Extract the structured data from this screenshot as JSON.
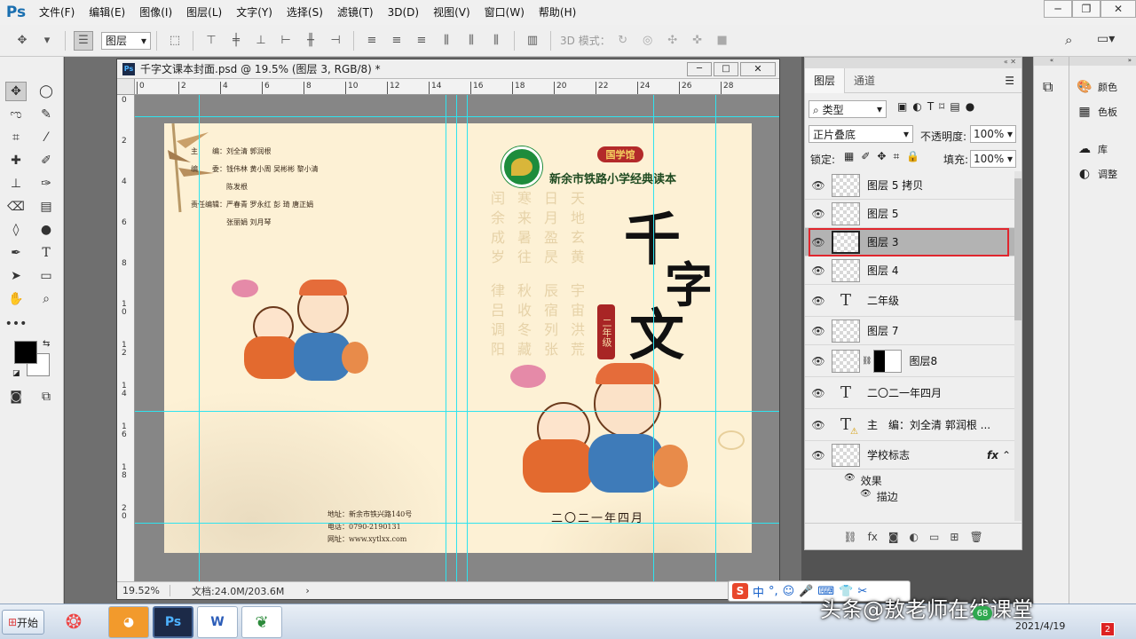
{
  "app": {
    "logo": "Ps"
  },
  "menu": [
    "文件(F)",
    "编辑(E)",
    "图像(I)",
    "图层(L)",
    "文字(Y)",
    "选择(S)",
    "滤镜(T)",
    "3D(D)",
    "视图(V)",
    "窗口(W)",
    "帮助(H)"
  ],
  "options": {
    "auto_select_value": "图层",
    "mode_3d_label": "3D 模式："
  },
  "document": {
    "tab_title": "千字文课本封面.psd @ 19.5% (图层 3, RGB/8) *",
    "zoom": "19.52%",
    "doc_size": "文档:24.0M/203.6M",
    "ruler_h": [
      "0",
      "2",
      "4",
      "6",
      "8",
      "10",
      "12",
      "14",
      "16",
      "18",
      "20",
      "22",
      "24",
      "26",
      "28"
    ],
    "ruler_v": [
      "0",
      "2",
      "4",
      "6",
      "8",
      "1\n0",
      "1\n2",
      "1\n4",
      "1\n6",
      "1\n8",
      "2\n0"
    ]
  },
  "cover": {
    "credits": [
      "主　　编：刘全清  郭润根",
      "编　　委：钱伟林  黄小周  吴彬彬  黎小清",
      "　　　　　陈发根",
      "责任编辑：严春青  罗永红  彭  琦  唐正娟",
      "　　　　　张丽娟  刘月琴"
    ],
    "badge": "国学馆",
    "school": "新余市铁路小学经典读本",
    "main_title": "千字文",
    "grade": "二年级",
    "date": "二〇二一年四月",
    "address": "地址：新余市铁兴路140号",
    "phone": "电话：0790-2190131",
    "website": "网址：www.xytlxx.com",
    "bg_columns": [
      "天地玄黄",
      "日月盈昃",
      "寒来暑往",
      "闰余成岁",
      "宇宙洪荒",
      "辰宿列张",
      "秋收冬藏",
      "律吕调阳"
    ]
  },
  "layers_panel": {
    "tabs": [
      "图层",
      "通道"
    ],
    "filter_kind": "类型",
    "blend_mode": "正片叠底",
    "opacity_label": "不透明度:",
    "opacity_value": "100%",
    "lock_label": "锁定:",
    "fill_label": "填充:",
    "fill_value": "100%",
    "layers": [
      {
        "name": "图层 5 拷贝",
        "kind": "pixel",
        "selected": false
      },
      {
        "name": "图层 5",
        "kind": "pixel",
        "selected": false
      },
      {
        "name": "图层 3",
        "kind": "pixel",
        "selected": true
      },
      {
        "name": "图层 4",
        "kind": "pixel",
        "selected": false
      },
      {
        "name": "二年级",
        "kind": "text",
        "selected": false
      },
      {
        "name": "图层 7",
        "kind": "pixel",
        "selected": false
      },
      {
        "name": "图层8",
        "kind": "mask",
        "selected": false
      },
      {
        "name": "二〇二一年四月",
        "kind": "text",
        "selected": false
      },
      {
        "name": "主　编：刘全清 郭润根 ...",
        "kind": "text-warn",
        "selected": false
      },
      {
        "name": "学校标志",
        "kind": "pixel",
        "selected": false
      }
    ],
    "effects_label": "效果",
    "stroke_label": "描边",
    "fx": "fx"
  },
  "side_panels": [
    "颜色",
    "色板",
    "库",
    "调整"
  ],
  "taskbar": {
    "start": "开始",
    "ime_label": "中",
    "watermark": "头条@敖老师在线课堂",
    "date": "2021/4/19",
    "notif_count": "2",
    "badge": "68"
  }
}
